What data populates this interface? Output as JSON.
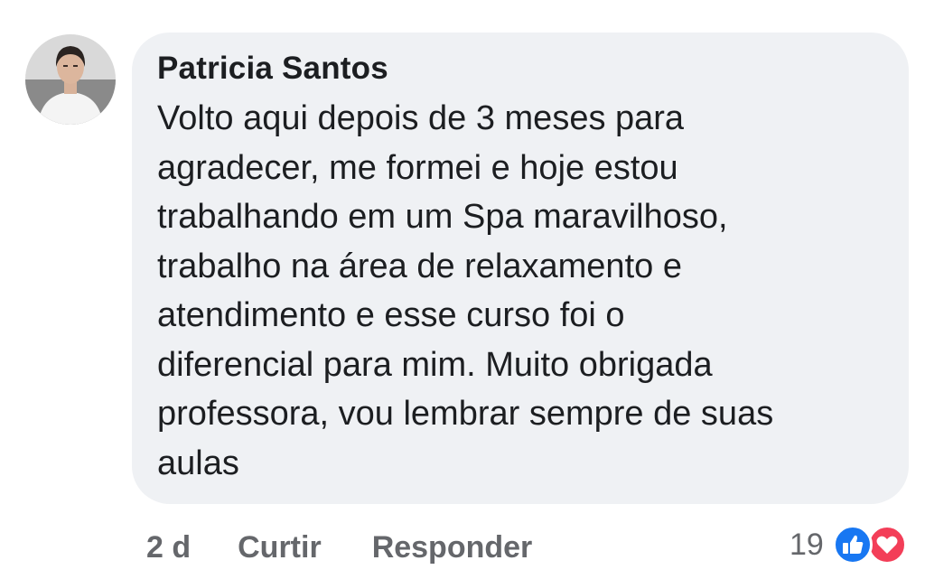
{
  "comment": {
    "author": "Patricia Santos",
    "text": "Volto aqui depois de 3 meses para\nagradecer, me formei e hoje estou\ntrabalhando em um Spa maravilhoso,\ntrabalho na área de relaxamento e\natendimento e esse curso foi o\ndiferencial para mim. Muito obrigada\nprofessora, vou lembrar sempre de suas\naulas",
    "time": "2 d",
    "like_label": "Curtir",
    "reply_label": "Responder",
    "reaction_count": "19",
    "reactions": [
      "like-icon",
      "love-icon"
    ]
  },
  "colors": {
    "bubble": "#eff1f4",
    "text": "#1c1e21",
    "secondary": "#65676b",
    "like": "#1877f2",
    "love": "#f33e58"
  }
}
